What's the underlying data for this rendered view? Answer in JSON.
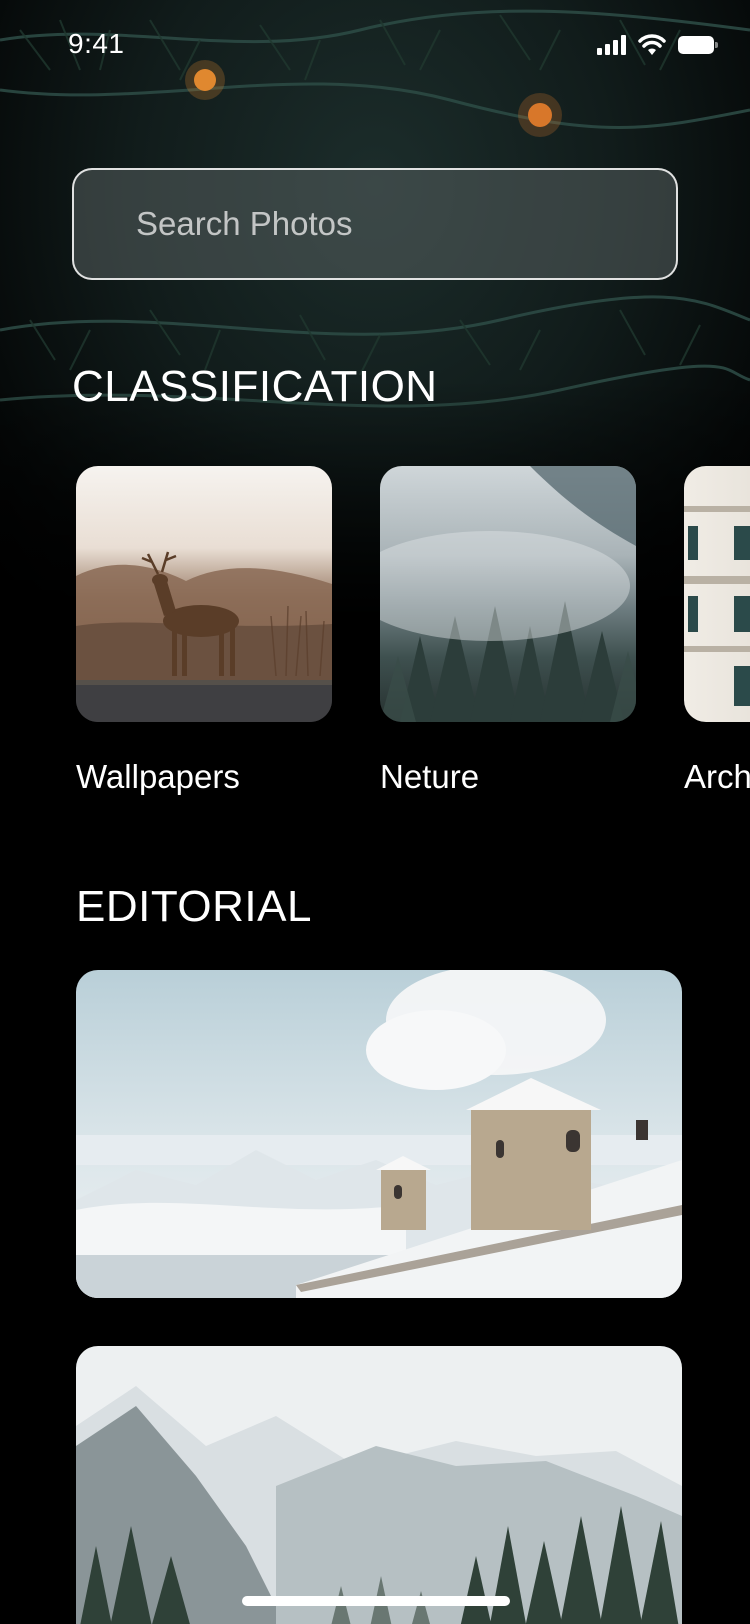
{
  "status_bar": {
    "time": "9:41",
    "icons": [
      "cellular-signal-icon",
      "wifi-icon",
      "battery-icon"
    ]
  },
  "search": {
    "placeholder": "Search Photos"
  },
  "classification": {
    "title": "CLASSIFICATION",
    "items": [
      {
        "label": "Wallpapers",
        "image": "deer-on-misty-road"
      },
      {
        "label": "Neture",
        "image": "misty-pine-forest"
      },
      {
        "label": "Arch",
        "image": "classic-building-facade"
      }
    ]
  },
  "editorial": {
    "title": "EDITORIAL",
    "items": [
      {
        "image": "snowy-rooftops-with-chimney-smoke"
      },
      {
        "image": "snowy-forested-mountains"
      }
    ]
  },
  "colors": {
    "background": "#000000",
    "text": "#ffffff",
    "search_border": "#d9d9d9"
  }
}
